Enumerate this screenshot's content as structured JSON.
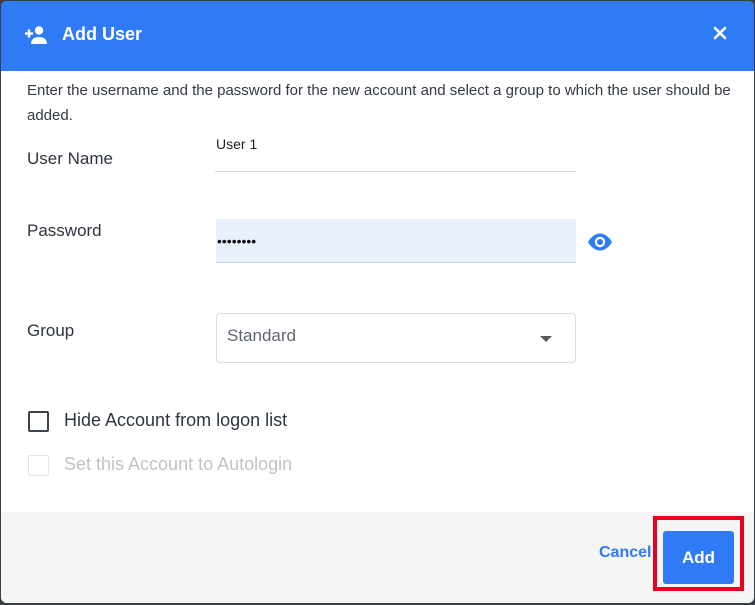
{
  "dialog": {
    "title": "Add User",
    "description": "Enter the username and the password for the new account and select a group to which the user should be added."
  },
  "fields": {
    "username_label": "User Name",
    "username_value": "User 1",
    "password_label": "Password",
    "password_value": "••••••••",
    "group_label": "Group",
    "group_value": "Standard"
  },
  "options": {
    "hide_account_label": "Hide Account from logon list",
    "hide_account_checked": false,
    "autologin_label": "Set this Account to Autologin",
    "autologin_checked": false,
    "autologin_disabled": true
  },
  "footer": {
    "cancel_label": "Cancel",
    "add_label": "Add"
  },
  "colors": {
    "accent": "#2f7bf5",
    "highlight": "#e8001e",
    "password_fill": "#e8f0fe"
  },
  "icons": {
    "title": "add-user-icon",
    "close": "close-icon",
    "password_toggle": "eye-icon",
    "dropdown": "caret-down-icon"
  }
}
